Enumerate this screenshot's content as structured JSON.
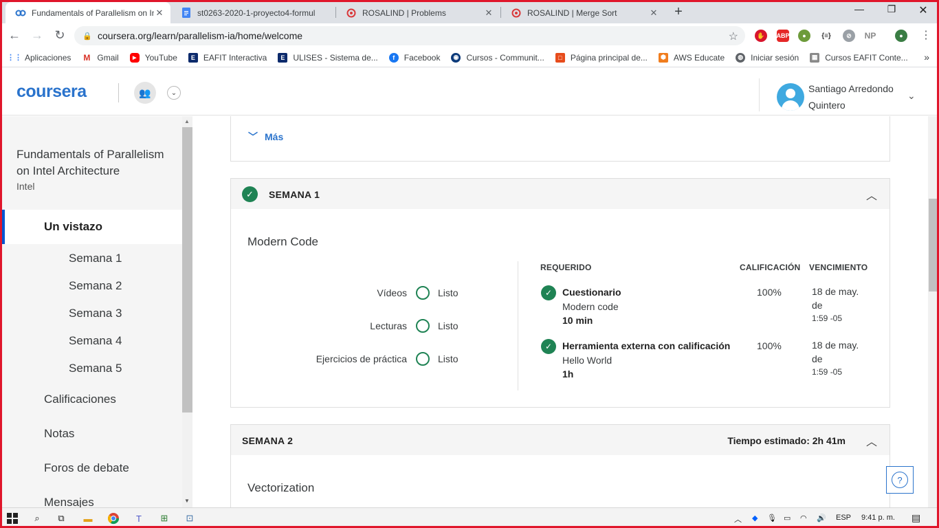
{
  "browser": {
    "tabs": [
      {
        "title": "Fundamentals of Parallelism on Int",
        "active": true
      },
      {
        "title": "st0263-2020-1-proyecto4-formul",
        "active": false
      },
      {
        "title": "ROSALIND | Problems",
        "active": false
      },
      {
        "title": "ROSALIND | Merge Sort",
        "active": false
      }
    ],
    "url": "coursera.org/learn/parallelism-ia/home/welcome",
    "extensions": {
      "abp": "ABP",
      "np": "NP"
    },
    "bookmarks": [
      {
        "label": "Aplicaciones",
        "icon": "apps-grid-icon"
      },
      {
        "label": "Gmail",
        "icon": "gmail-icon"
      },
      {
        "label": "YouTube",
        "icon": "youtube-icon"
      },
      {
        "label": "EAFIT Interactiva",
        "icon": "eafit-icon"
      },
      {
        "label": "ULISES - Sistema de...",
        "icon": "ulises-icon"
      },
      {
        "label": "Facebook",
        "icon": "facebook-icon"
      },
      {
        "label": "Cursos - Communit...",
        "icon": "globe-icon"
      },
      {
        "label": "Página principal de...",
        "icon": "office-icon"
      },
      {
        "label": "AWS Educate",
        "icon": "aws-icon"
      },
      {
        "label": "Iniciar sesión",
        "icon": "globe-icon"
      },
      {
        "label": "Cursos EAFIT Conte...",
        "icon": "eafit-icon"
      }
    ]
  },
  "header": {
    "logo": "coursera",
    "user_name": "Santiago Arredondo Quintero"
  },
  "sidebar": {
    "course_title": "Fundamentals of Parallelism on Intel Architecture",
    "org": "Intel",
    "active_item": "Un vistazo",
    "weeks": [
      "Semana 1",
      "Semana 2",
      "Semana 3",
      "Semana 4",
      "Semana 5"
    ],
    "items": [
      "Calificaciones",
      "Notas",
      "Foros de debate",
      "Mensajes"
    ]
  },
  "main": {
    "more_label": "Más",
    "week1": {
      "title": "SEMANA 1",
      "module_title": "Modern Code",
      "stats": [
        {
          "label": "Vídeos",
          "status": "Listo"
        },
        {
          "label": "Lecturas",
          "status": "Listo"
        },
        {
          "label": "Ejercicios de práctica",
          "status": "Listo"
        }
      ],
      "columns": {
        "required": "REQUERIDO",
        "grade": "CALIFICACIÓN",
        "due": "VENCIMIENTO"
      },
      "items": [
        {
          "type": "Cuestionario",
          "name": "Modern code",
          "duration": "10 min",
          "grade": "100%",
          "due_date": "18 de may. de",
          "due_time": "1:59 -05"
        },
        {
          "type": "Herramienta externa con calificación",
          "name": "Hello World",
          "duration": "1h",
          "grade": "100%",
          "due_date": "18 de may. de",
          "due_time": "1:59 -05"
        }
      ]
    },
    "week2": {
      "title": "SEMANA 2",
      "estimated": "Tiempo estimado: 2h 41m",
      "module_title": "Vectorization"
    },
    "help_label": "?"
  },
  "taskbar": {
    "language": "ESP",
    "time": "9:41 p. m."
  },
  "colors": {
    "accent": "#2a73cc",
    "success": "#1f8354",
    "nav_active": "#0056d2",
    "frame": "#e0162b"
  }
}
